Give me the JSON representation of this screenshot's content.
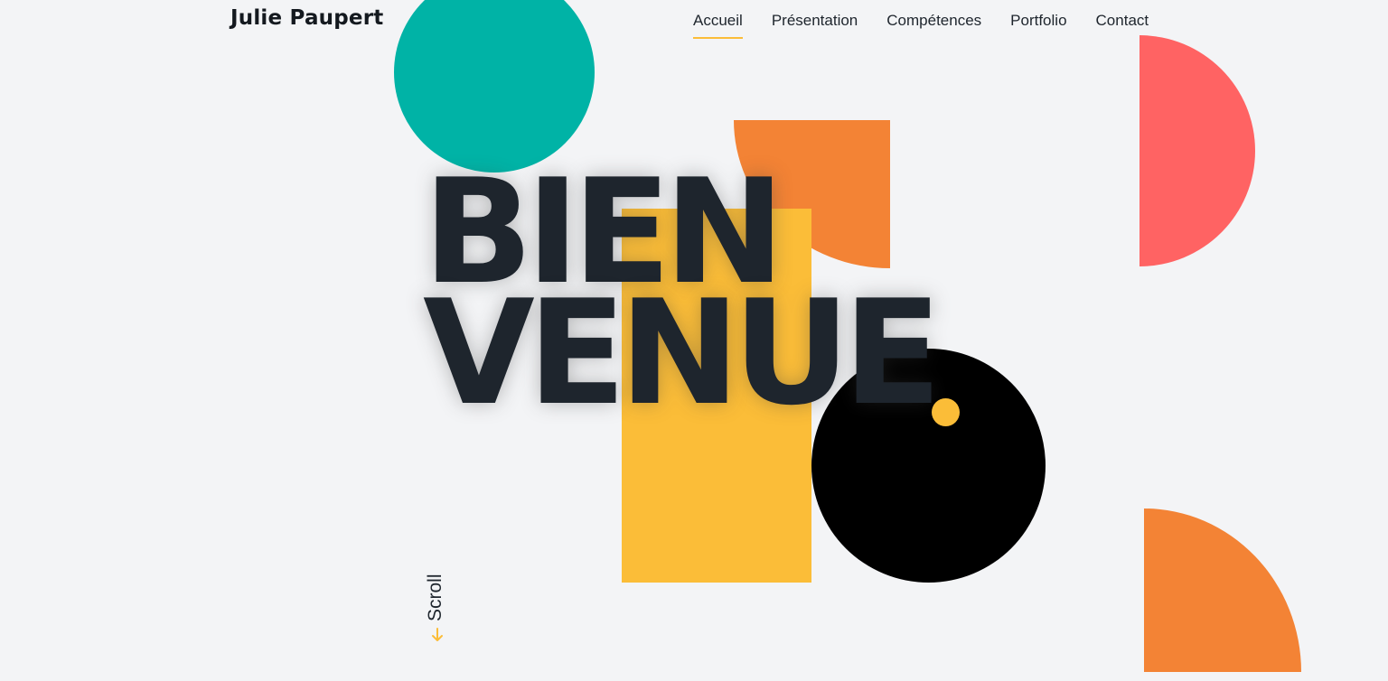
{
  "brand": {
    "name": "Julie Paupert"
  },
  "nav": {
    "items": [
      {
        "label": "Accueil",
        "active": true
      },
      {
        "label": "Présentation",
        "active": false
      },
      {
        "label": "Compétences",
        "active": false
      },
      {
        "label": "Portfolio",
        "active": false
      },
      {
        "label": "Contact",
        "active": false
      }
    ]
  },
  "hero": {
    "line1": "BIEN",
    "line2": "VENUE"
  },
  "scroll": {
    "label": "Scroll",
    "icon": "arrow-down-icon"
  },
  "colors": {
    "background": "#f3f4f6",
    "text": "#1e252d",
    "accent_yellow": "#fbbd38",
    "teal": "#00b3a6",
    "orange": "#f38335",
    "coral": "#ff6363",
    "black": "#000000"
  }
}
